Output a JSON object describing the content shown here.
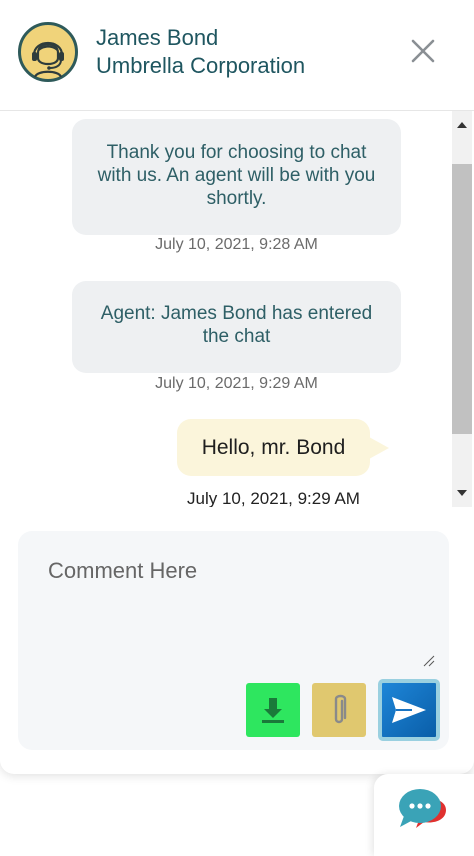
{
  "header": {
    "agent_name": "James Bond",
    "company": "Umbrella Corporation",
    "avatar_icon": "headset-agent-icon",
    "close_icon": "close-icon"
  },
  "messages": [
    {
      "type": "system",
      "text": "Thank you for choosing to chat with us. An agent will be with you shortly.",
      "timestamp": "July 10, 2021, 9:28 AM"
    },
    {
      "type": "system",
      "text": "Agent: James Bond has entered the chat",
      "timestamp": "July 10, 2021, 9:29 AM"
    },
    {
      "type": "user",
      "text": "Hello, mr. Bond",
      "timestamp": "July 10, 2021, 9:29 AM"
    }
  ],
  "composer": {
    "placeholder": "Comment Here",
    "value": "",
    "download_icon": "download-icon",
    "attach_icon": "paperclip-icon",
    "send_icon": "send-icon"
  },
  "launcher": {
    "icon": "chat-bubbles-icon"
  },
  "colors": {
    "accent_text": "#1f5660",
    "download_btn": "#2ee65f",
    "attach_btn": "#e0c86f",
    "send_btn": "#1e86d8",
    "user_bubble": "#fbf5db",
    "system_bubble": "#eef0f2"
  }
}
